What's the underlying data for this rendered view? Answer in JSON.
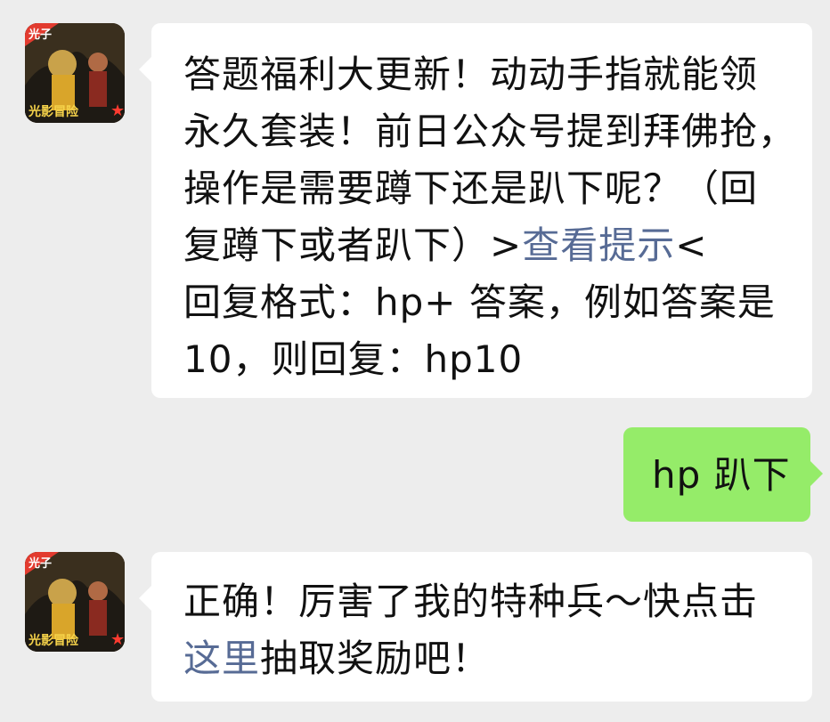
{
  "avatar": {
    "name": "光子光影冒险",
    "badge_top": "光子",
    "badge_bottom": "光影冒险"
  },
  "messages": [
    {
      "side": "left",
      "lines": [
        [
          "答题福利大更新！动动手指就能领"
        ],
        [
          "永久套装！前日公众号提到拜佛抢，"
        ],
        [
          "操作是需要蹲下还是趴下呢？（回"
        ],
        [
          "复蹲下或者趴下）>",
          "查看提示",
          "<"
        ],
        [
          "回复格式：hp+ 答案，例如答案是"
        ],
        [
          "10，则回复：hp10"
        ]
      ]
    },
    {
      "side": "right",
      "text": "hp 趴下"
    },
    {
      "side": "left",
      "lines": [
        [
          "正确！厉害了我的特种兵～快点击"
        ],
        [
          "这里",
          "抽取奖励吧！"
        ]
      ]
    }
  ],
  "colors": {
    "background": "#ededed",
    "bubble_in": "#ffffff",
    "bubble_out": "#95ec69",
    "link": "#576b95"
  }
}
